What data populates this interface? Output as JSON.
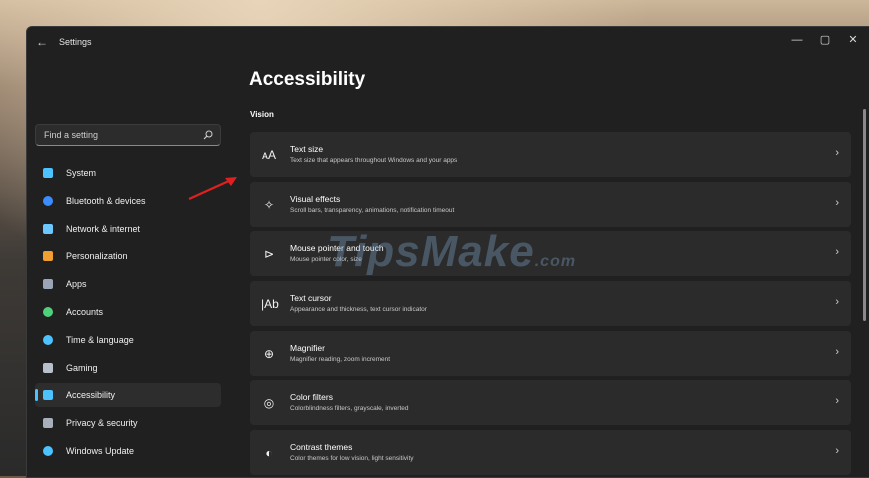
{
  "window": {
    "title": "Settings",
    "back_icon": "back-arrow-icon",
    "controls": {
      "minimize": "—",
      "maximize": "▢",
      "close": "✕"
    }
  },
  "search": {
    "placeholder": "Find a setting",
    "value": ""
  },
  "sidebar": {
    "items": [
      {
        "label": "System",
        "icon": "monitor-icon",
        "color": "#4cc2ff",
        "active": false
      },
      {
        "label": "Bluetooth & devices",
        "icon": "bluetooth-icon",
        "color": "#3b8cff",
        "active": false
      },
      {
        "label": "Network & internet",
        "icon": "wifi-icon",
        "color": "#6cc7ff",
        "active": false
      },
      {
        "label": "Personalization",
        "icon": "brush-icon",
        "color": "#f0a030",
        "active": false
      },
      {
        "label": "Apps",
        "icon": "apps-icon",
        "color": "#9aa6b8",
        "active": false
      },
      {
        "label": "Accounts",
        "icon": "person-icon",
        "color": "#4fd07a",
        "active": false
      },
      {
        "label": "Time & language",
        "icon": "globe-clock-icon",
        "color": "#4cc2ff",
        "active": false
      },
      {
        "label": "Gaming",
        "icon": "gamepad-icon",
        "color": "#b8c0cc",
        "active": false
      },
      {
        "label": "Accessibility",
        "icon": "accessibility-icon",
        "color": "#4cc2ff",
        "active": true
      },
      {
        "label": "Privacy & security",
        "icon": "shield-icon",
        "color": "#a8b0bc",
        "active": false
      },
      {
        "label": "Windows Update",
        "icon": "update-icon",
        "color": "#4cc2ff",
        "active": false
      }
    ]
  },
  "main": {
    "title": "Accessibility",
    "section": "Vision",
    "cards": [
      {
        "title": "Text size",
        "description": "Text size that appears throughout Windows and your apps",
        "icon": "text-size-icon",
        "glyph": "ᴀA"
      },
      {
        "title": "Visual effects",
        "description": "Scroll bars, transparency, animations, notification timeout",
        "icon": "sparkle-icon",
        "glyph": "✧"
      },
      {
        "title": "Mouse pointer and touch",
        "description": "Mouse pointer color, size",
        "icon": "pointer-icon",
        "glyph": "⊳"
      },
      {
        "title": "Text cursor",
        "description": "Appearance and thickness, text cursor indicator",
        "icon": "text-cursor-icon",
        "glyph": "|Ab"
      },
      {
        "title": "Magnifier",
        "description": "Magnifier reading, zoom increment",
        "icon": "magnifier-icon",
        "glyph": "⊕"
      },
      {
        "title": "Color filters",
        "description": "Colorblindness filters, grayscale, inverted",
        "icon": "color-filter-icon",
        "glyph": "◎"
      },
      {
        "title": "Contrast themes",
        "description": "Color themes for low vision, light sensitivity",
        "icon": "contrast-icon",
        "glyph": "◐"
      }
    ],
    "chevron": "›"
  },
  "watermark": {
    "text": "TipsMake",
    "suffix": ".com"
  }
}
